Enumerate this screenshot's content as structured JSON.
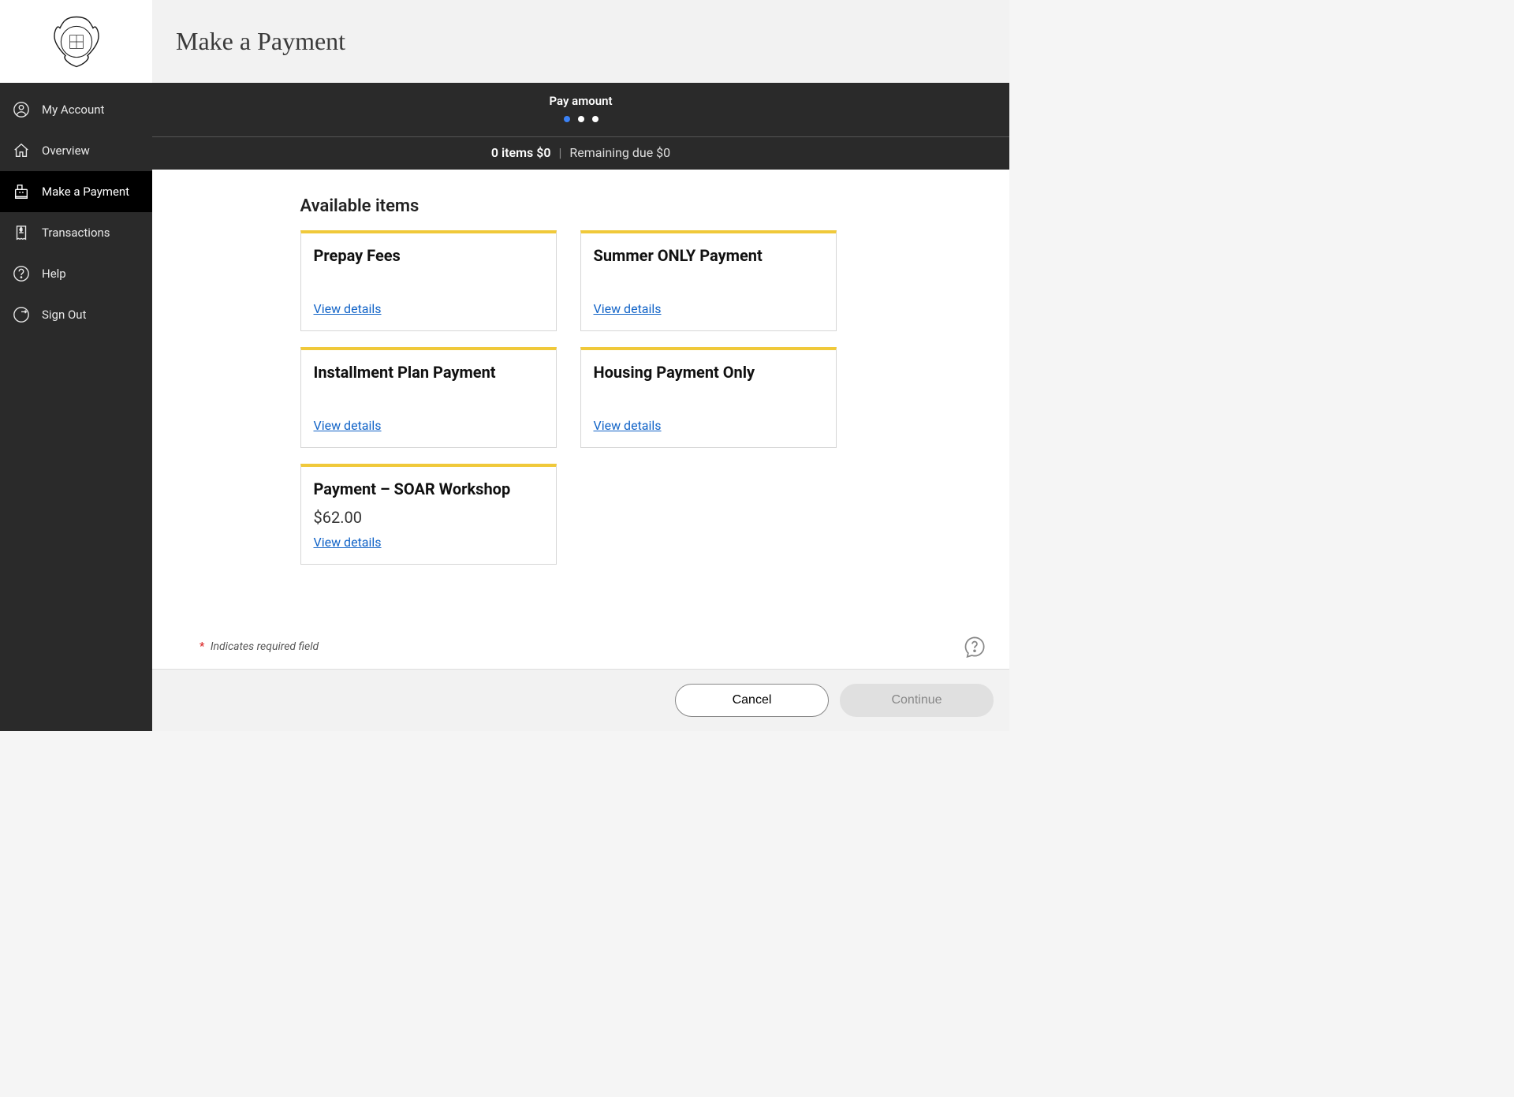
{
  "sidebar": {
    "items": [
      {
        "label": "My Account"
      },
      {
        "label": "Overview"
      },
      {
        "label": "Make a Payment"
      },
      {
        "label": "Transactions"
      },
      {
        "label": "Help"
      },
      {
        "label": "Sign Out"
      }
    ]
  },
  "header": {
    "title": "Make a Payment"
  },
  "stepper": {
    "label": "Pay amount",
    "summary_items": "0 items",
    "summary_amount": "$0",
    "remaining_label": "Remaining due",
    "remaining_amount": "$0"
  },
  "section": {
    "title": "Available items"
  },
  "cards": [
    {
      "title": "Prepay Fees",
      "price": "",
      "link": "View details"
    },
    {
      "title": "Summer ONLY Payment",
      "price": "",
      "link": "View details"
    },
    {
      "title": "Installment Plan Payment",
      "price": "",
      "link": "View details"
    },
    {
      "title": "Housing Payment Only",
      "price": "",
      "link": "View details"
    },
    {
      "title": "Payment – SOAR Workshop",
      "price": "$62.00",
      "link": "View details"
    }
  ],
  "required_note": "Indicates required field",
  "footer": {
    "cancel": "Cancel",
    "continue": "Continue"
  }
}
